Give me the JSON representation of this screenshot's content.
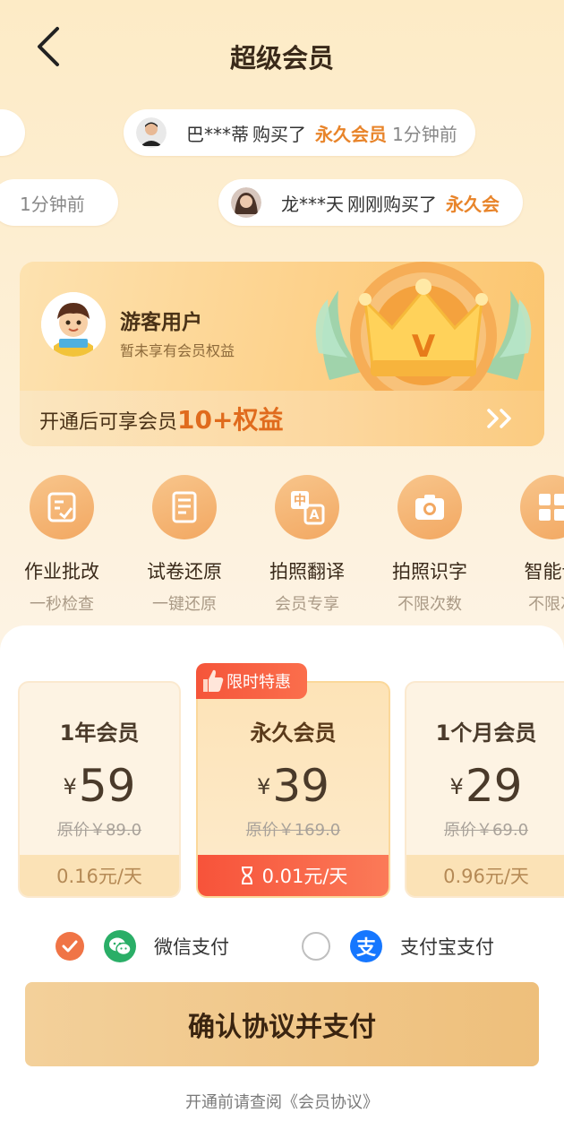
{
  "header": {
    "title": "超级会员"
  },
  "ticker": [
    {
      "name": "巴***蒂",
      "verb": "购买了",
      "product": "永久会员",
      "ago": "1分钟前"
    },
    {
      "name": "",
      "verb": "",
      "product": "",
      "ago": "1分钟前"
    },
    {
      "name": "龙***天",
      "verb": "刚刚购买了",
      "product": "永久会",
      "ago": ""
    }
  ],
  "user": {
    "name": "游客用户",
    "subtitle": "暂未享有会员权益"
  },
  "benefits": {
    "prefix": "开通后可享会员",
    "count": "10+",
    "suffix": "权益"
  },
  "crown_letter": "V",
  "features": [
    {
      "title": "作业批改",
      "subtitle": "一秒检查",
      "icon": "homework-check-icon"
    },
    {
      "title": "试卷还原",
      "subtitle": "一键还原",
      "icon": "paper-restore-icon"
    },
    {
      "title": "拍照翻译",
      "subtitle": "会员专享",
      "icon": "translate-icon"
    },
    {
      "title": "拍照识字",
      "subtitle": "不限次数",
      "icon": "camera-icon"
    },
    {
      "title": "智能计",
      "subtitle": "不限次",
      "icon": "calculator-icon"
    }
  ],
  "plans": [
    {
      "name": "1年会员",
      "currency": "¥",
      "price": "59",
      "original": "原价￥89.0",
      "per_day": "0.16元/天",
      "selected": false
    },
    {
      "name": "永久会员",
      "currency": "¥",
      "price": "39",
      "original": "原价￥169.0",
      "per_day": "0.01元/天",
      "selected": true
    },
    {
      "name": "1个月会员",
      "currency": "¥",
      "price": "29",
      "original": "原价￥69.0",
      "per_day": "0.96元/天",
      "selected": false
    }
  ],
  "badge": "限时特惠",
  "payment": {
    "wechat": {
      "label": "微信支付",
      "selected": true
    },
    "alipay": {
      "label": "支付宝支付",
      "selected": false,
      "glyph": "支"
    }
  },
  "confirm_label": "确认协议并支付",
  "agreement": "开通前请查阅《会员协议》",
  "colors": {
    "accent": "#e8842a",
    "red": "#f5553a",
    "wechat": "#2aae67",
    "alipay": "#1677ff",
    "gold": "#eebf7b"
  }
}
